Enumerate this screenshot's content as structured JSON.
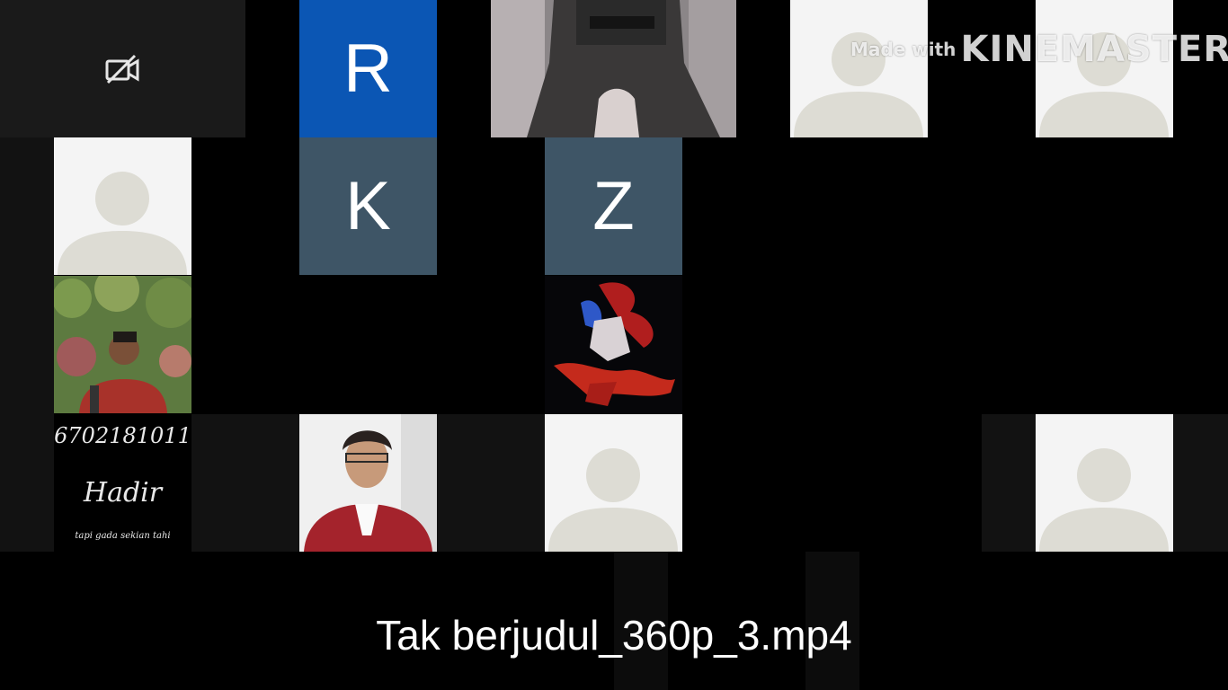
{
  "watermark": {
    "prefix": "Made with",
    "brand": "KINEMASTER"
  },
  "participants": [
    {
      "kind": "camera-off",
      "icon": "video-off-icon"
    },
    {
      "kind": "initial",
      "initial": "R",
      "color": "#0b56b4"
    },
    {
      "kind": "video",
      "description": "masked figure"
    },
    {
      "kind": "default-avatar"
    },
    {
      "kind": "default-avatar"
    },
    {
      "kind": "default-avatar"
    },
    {
      "kind": "initial",
      "initial": "K",
      "color": "#3e5566"
    },
    {
      "kind": "initial",
      "initial": "Z",
      "color": "#3e5566"
    },
    {
      "kind": "photo"
    },
    {
      "kind": "black"
    },
    {
      "kind": "artwork"
    },
    {
      "kind": "note",
      "lines": [
        "6702181011",
        "Hadir",
        "tapi gada sekian tahi"
      ]
    },
    {
      "kind": "photo"
    },
    {
      "kind": "default-avatar"
    },
    {
      "kind": "default-avatar"
    }
  ],
  "caption": "Tak berjudul_360p_3.mp4"
}
